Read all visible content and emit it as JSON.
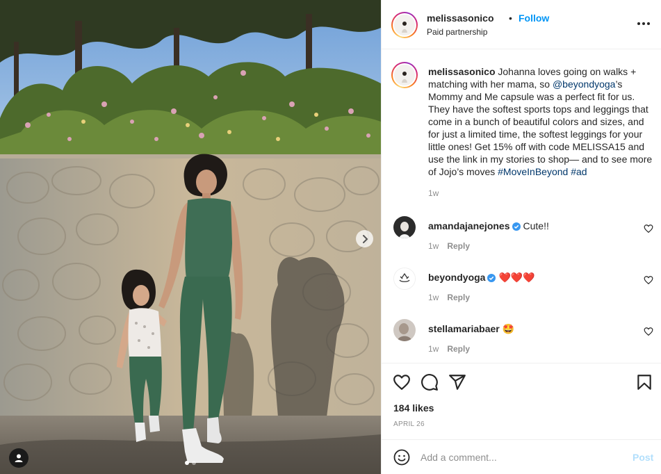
{
  "post": {
    "username": "melissasonico",
    "follow_label": "Follow",
    "subtitle": "Paid partnership",
    "separator": "•",
    "more_icon": "more-horizontal-icon"
  },
  "caption": {
    "username": "melissasonico",
    "text_1": " Johanna loves going on walks + matching with her mama, so ",
    "mention": "@beyondyoga",
    "text_2": "’s Mommy and Me capsule was a perfect fit for us. They have the softest sports tops and leggings that come in a bunch of beautiful colors and sizes, and for just a limited time, the softest leggings for your little ones! Get 15% off with code MELISSA15 and use the link in my stories to shop— and to see more of Jojo’s moves ",
    "hashtag_1": "#MoveInBeyond",
    "hashtag_2": "#ad",
    "time": "1w"
  },
  "comments": [
    {
      "username": "amandajanejones",
      "verified": true,
      "text": "Cute!!",
      "time": "1w",
      "reply_label": "Reply"
    },
    {
      "username": "beyondyoga",
      "verified": true,
      "text": "❤️❤️❤️",
      "time": "1w",
      "reply_label": "Reply"
    },
    {
      "username": "stellamariabaer",
      "verified": false,
      "text": "🤩",
      "time": "1w",
      "reply_label": "Reply"
    }
  ],
  "actions": {
    "icons": [
      "heart-icon",
      "comment-icon",
      "share-icon",
      "save-icon"
    ],
    "likes": "184 likes",
    "date": "APRIL 26"
  },
  "add_comment": {
    "placeholder": "Add a comment...",
    "post_label": "Post"
  },
  "media": {
    "carousel_dots": 2,
    "active_dot": 0
  },
  "colors": {
    "accent": "#0095f6",
    "link": "#00376b",
    "muted": "#8e8e8e",
    "heart": "#ed4956"
  }
}
